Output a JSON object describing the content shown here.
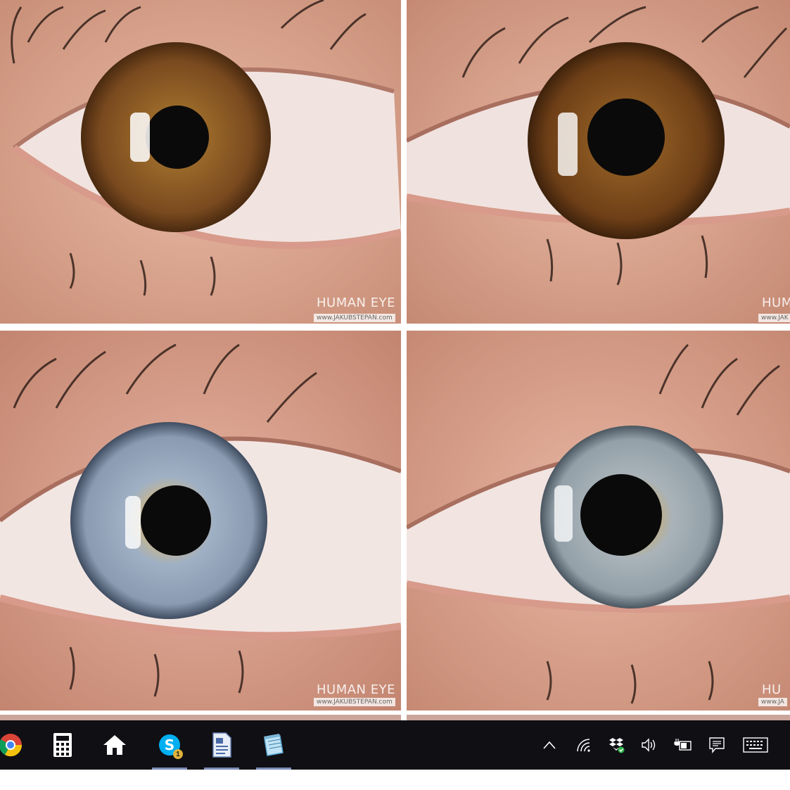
{
  "tiles": [
    {
      "watermark": "HUMAN EYE",
      "watermark_url": "www.JAKUBSTEPAN.com",
      "iris_color": "#7a4a1f",
      "iris_ring": "#5a3312"
    },
    {
      "watermark": "HUM",
      "watermark_url": "www.JAK",
      "iris_color": "#6e3f17",
      "iris_ring": "#4c2a0e"
    },
    {
      "watermark": "HUMAN EYE",
      "watermark_url": "www.JAKUBSTEPAN.com",
      "iris_color": "#8a9bb2",
      "iris_ring": "#3f4c60"
    },
    {
      "watermark": "HU",
      "watermark_url": "www.JA",
      "iris_color": "#93a0a8",
      "iris_ring": "#4a5660"
    }
  ],
  "taskbar": {
    "apps": [
      {
        "name": "chrome-icon"
      },
      {
        "name": "calculator-icon"
      },
      {
        "name": "home-icon"
      },
      {
        "name": "skype-icon",
        "badge": "1"
      },
      {
        "name": "document-viewer-icon"
      },
      {
        "name": "notepad-icon"
      }
    ],
    "tray": [
      {
        "name": "chevron-up-icon"
      },
      {
        "name": "wifi-icon"
      },
      {
        "name": "dropbox-icon"
      },
      {
        "name": "volume-icon"
      },
      {
        "name": "battery-icon"
      },
      {
        "name": "notifications-icon"
      },
      {
        "name": "keyboard-icon"
      }
    ],
    "background": "#0f0f14"
  }
}
